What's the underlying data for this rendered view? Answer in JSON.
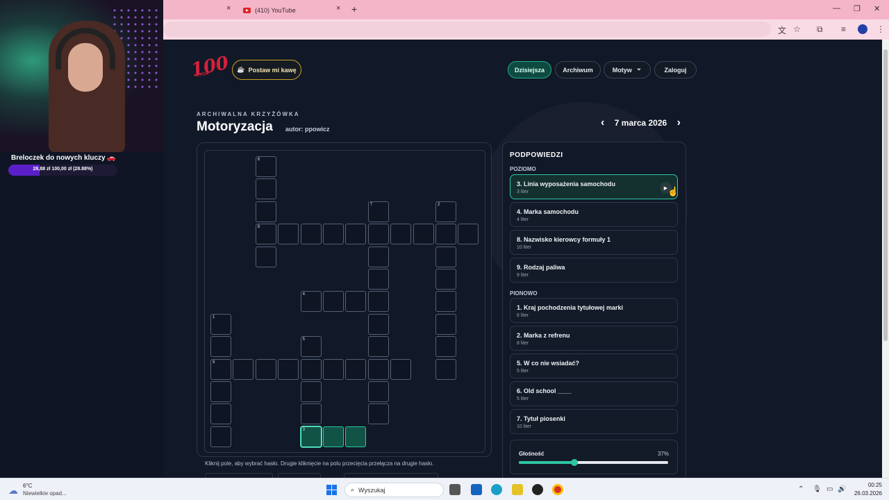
{
  "browser": {
    "tabs": [
      {
        "label": ""
      },
      {
        "label": "(410) YouTube"
      }
    ],
    "new_tab": "+",
    "close_glyph": "×",
    "window_controls": [
      "—",
      "❐",
      "✕"
    ]
  },
  "stream": {
    "goal_title": "Breloczek do nowych kluczy 🚗",
    "goal_progress": "28,88 zł   100,00 zł (28.88%)",
    "goal_fraction": 0.2888
  },
  "site": {
    "logo": "100",
    "logo_sub": "HITÓW",
    "coffee_label": "Postaw mi kawę",
    "nav": [
      {
        "label": "Dzisiejsza",
        "active": true
      },
      {
        "label": "Archiwum",
        "active": false
      },
      {
        "label": "Motyw",
        "active": false
      },
      {
        "label": "Zaloguj",
        "active": false
      }
    ],
    "motyw_chevron": "⌄"
  },
  "puzzle": {
    "kicker": "ARCHIWALNA KRZYŻÓWKA",
    "title": "Motoryzacja",
    "author": "autor: ppowicz",
    "date": "7 marca 2026",
    "prev": "‹",
    "next": "›",
    "hint": "Kliknij pole, aby wybrać hasło. Drugie kliknięcie na polu przecięcia przełącza na drugie hasło."
  },
  "clues": {
    "heading": "PODPOWIEDZI",
    "across_label": "POZIOMO",
    "down_label": "PIONOWO",
    "across": [
      {
        "title": "3. Linia wyposażenia samochodu",
        "sub": "3 liter",
        "active": true
      },
      {
        "title": "4. Marka samochodu",
        "sub": "4 liter"
      },
      {
        "title": "8. Nazwisko kierowcy formuły 1",
        "sub": "10 liter"
      },
      {
        "title": "9. Rodzaj paliwa",
        "sub": "9 liter"
      }
    ],
    "down": [
      {
        "title": "1. Kraj pochodzenia tytułowej marki",
        "sub": "6 liter"
      },
      {
        "title": "2. Marka z refrenu",
        "sub": "8 liter"
      },
      {
        "title": "5. W co nie wsiadać?",
        "sub": "5 liter"
      },
      {
        "title": "6. Old school ____",
        "sub": "5 liter"
      },
      {
        "title": "7. Tytuł piosenki",
        "sub": "10 liter"
      }
    ],
    "play_glyph": "▶",
    "volume_label": "Głośność",
    "volume_value": "37%",
    "volume_fraction": 0.37
  },
  "taskbar": {
    "weather_temp": "6°C",
    "weather_desc": "Niewielkie opad...",
    "search_placeholder": "Wyszukaj",
    "time": "00:25",
    "date": "26.03.2026"
  },
  "colors": {
    "accent": "#2ec7a2",
    "tabbar": "#f4b5c8",
    "page_bg": "#111827",
    "brand_red": "#d4213d"
  },
  "icons": [
    "translate-icon",
    "star-icon",
    "extensions-icon",
    "media-icon",
    "profile-icon",
    "menu-icon",
    "coffee-icon",
    "windows-icon",
    "search-icon"
  ]
}
